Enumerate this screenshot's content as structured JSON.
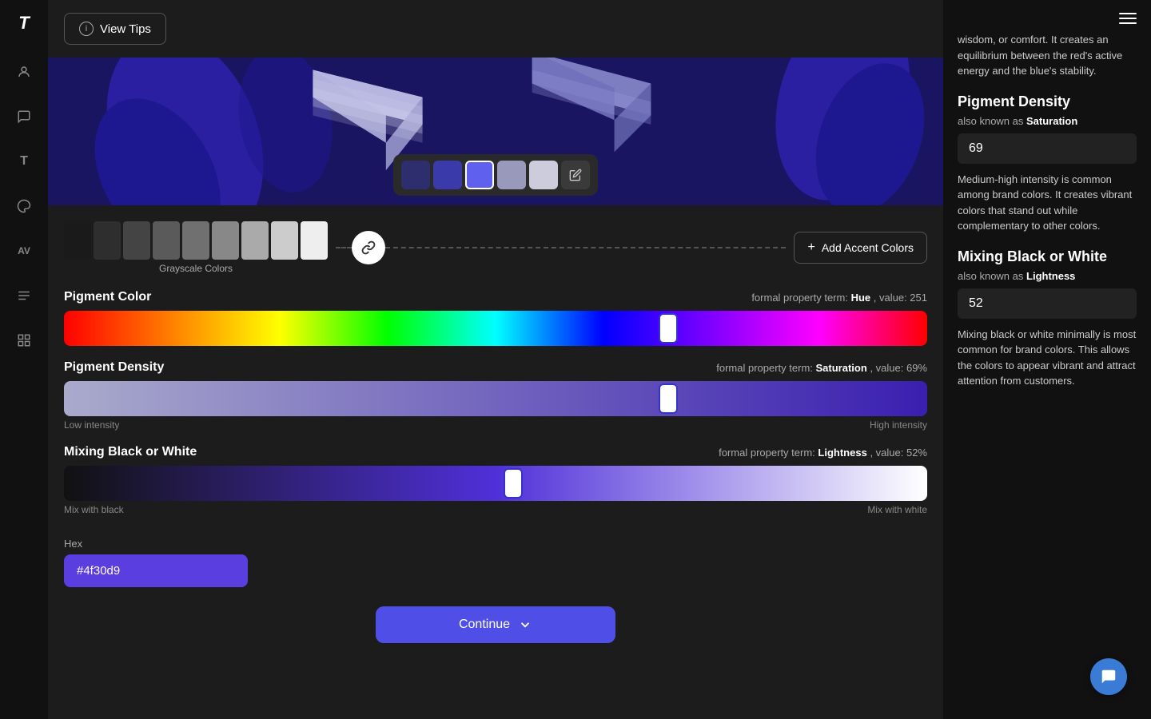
{
  "app": {
    "logo": "T",
    "hamburger_label": "menu"
  },
  "sidebar": {
    "icons": [
      {
        "name": "user-icon",
        "symbol": "👤"
      },
      {
        "name": "chat-icon",
        "symbol": "💬"
      },
      {
        "name": "text-icon",
        "symbol": "T"
      },
      {
        "name": "brush-icon",
        "symbol": "🖌"
      },
      {
        "name": "type-icon",
        "symbol": "AV"
      },
      {
        "name": "paragraph-icon",
        "symbol": "¶"
      },
      {
        "name": "grid-icon",
        "symbol": "⊞"
      }
    ]
  },
  "top_bar": {
    "view_tips_label": "View Tips"
  },
  "color_swatches": [
    {
      "color": "#2e2e6e",
      "active": false
    },
    {
      "color": "#3a3aaa",
      "active": false
    },
    {
      "color": "#6060ee",
      "active": true
    },
    {
      "color": "#9999bb",
      "active": false
    },
    {
      "color": "#ccccdd",
      "active": false
    }
  ],
  "grayscale": {
    "label": "Grayscale Colors",
    "swatches": [
      "#1a1a1a",
      "#2e2e2e",
      "#444444",
      "#5a5a5a",
      "#707070",
      "#888888",
      "#aaaaaa",
      "#cccccc",
      "#eeeeee"
    ]
  },
  "accent": {
    "add_label": "Add Accent Colors"
  },
  "pigment_color": {
    "title": "Pigment Color",
    "formal_label": "formal property term:",
    "formal_term": "Hue",
    "value_label": "value:",
    "value": "251",
    "thumb_pct": 70
  },
  "pigment_density": {
    "title": "Pigment Density",
    "formal_label": "formal property term:",
    "formal_term": "Saturation",
    "value_label": "value:",
    "value": "69%",
    "thumb_pct": 70,
    "label_low": "Low intensity",
    "label_high": "High intensity"
  },
  "mixing": {
    "title": "Mixing Black or White",
    "formal_label": "formal property term:",
    "formal_term": "Lightness",
    "value_label": "value:",
    "value": "52%",
    "thumb_pct": 52,
    "label_low": "Mix with black",
    "label_high": "Mix with white"
  },
  "hex": {
    "label": "Hex",
    "value": "#4f30d9"
  },
  "continue_btn": {
    "label": "Continue"
  },
  "right_panel": {
    "intro_text": "wisdom, or comfort. It creates an equilibrium between the red's active energy and the blue's stability.",
    "pigment_density": {
      "title": "Pigment Density",
      "also_known_label": "also known as",
      "also_known_term": "Saturation",
      "value": "69",
      "body": "Medium-high intensity is common among brand colors. It creates vibrant colors that stand out while complementary to other colors."
    },
    "mixing": {
      "title": "Mixing Black or White",
      "also_known_label": "also known as",
      "also_known_term": "Lightness",
      "value": "52",
      "body": "Mixing black or white minimally is most common for brand colors. This allows the colors to appear vibrant and attract attention from customers."
    }
  },
  "chat_bubble": {
    "icon": "💬"
  }
}
